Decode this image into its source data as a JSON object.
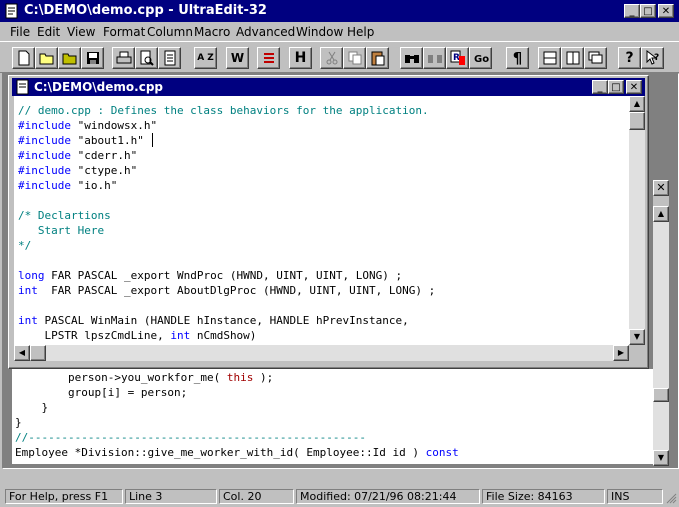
{
  "window": {
    "title": "C:\\DEMO\\demo.cpp - UltraEdit-32"
  },
  "menu": [
    "File",
    "Edit",
    "View",
    "Format",
    "Column",
    "Macro",
    "Advanced",
    "Window",
    "Help"
  ],
  "toolbar": {
    "az_label": "A Z",
    "wrap_label": "W",
    "h_label": "H",
    "pilcrow_label": "¶",
    "help_label": "?"
  },
  "child_window": {
    "title": "C:\\DEMO\\demo.cpp"
  },
  "editor_top": {
    "lines": [
      {
        "parts": [
          {
            "t": "// demo.cpp : Defines the class behaviors for the application.",
            "c": "com"
          }
        ]
      },
      {
        "parts": [
          {
            "t": "#include",
            "c": "kw"
          },
          {
            "t": " \"windowsx.h\"",
            "c": ""
          }
        ]
      },
      {
        "parts": [
          {
            "t": "#include",
            "c": "kw"
          },
          {
            "t": " \"about1.h\"",
            "c": ""
          }
        ]
      },
      {
        "parts": [
          {
            "t": "#include",
            "c": "kw"
          },
          {
            "t": " \"cderr.h\"",
            "c": ""
          }
        ]
      },
      {
        "parts": [
          {
            "t": "#include",
            "c": "kw"
          },
          {
            "t": " \"ctype.h\"",
            "c": ""
          }
        ]
      },
      {
        "parts": [
          {
            "t": "#include",
            "c": "kw"
          },
          {
            "t": " \"io.h\"",
            "c": ""
          }
        ]
      },
      {
        "parts": [
          {
            "t": "",
            "c": ""
          }
        ]
      },
      {
        "parts": [
          {
            "t": "/* Declartions",
            "c": "com"
          }
        ]
      },
      {
        "parts": [
          {
            "t": "   Start Here",
            "c": "com"
          }
        ]
      },
      {
        "parts": [
          {
            "t": "*/",
            "c": "com"
          }
        ]
      },
      {
        "parts": [
          {
            "t": "",
            "c": ""
          }
        ]
      },
      {
        "parts": [
          {
            "t": "long",
            "c": "kw"
          },
          {
            "t": " FAR PASCAL _export WndProc (HWND, UINT, UINT, LONG) ;",
            "c": ""
          }
        ]
      },
      {
        "parts": [
          {
            "t": "int",
            "c": "kw"
          },
          {
            "t": "  FAR PASCAL _export AboutDlgProc (HWND, UINT, UINT, LONG) ;",
            "c": ""
          }
        ]
      },
      {
        "parts": [
          {
            "t": "",
            "c": ""
          }
        ]
      },
      {
        "parts": [
          {
            "t": "int",
            "c": "kw"
          },
          {
            "t": " PASCAL WinMain (HANDLE hInstance, HANDLE hPrevInstance,",
            "c": ""
          }
        ]
      },
      {
        "parts": [
          {
            "t": "    LPSTR lpszCmdLine, ",
            "c": ""
          },
          {
            "t": "int",
            "c": "kw"
          },
          {
            "t": " nCmdShow)",
            "c": ""
          }
        ]
      }
    ]
  },
  "editor_bottom": {
    "lines": [
      {
        "parts": [
          {
            "t": "        person->you_workfor_me( ",
            "c": ""
          },
          {
            "t": "this",
            "c": "red"
          },
          {
            "t": " );",
            "c": ""
          }
        ]
      },
      {
        "parts": [
          {
            "t": "        group[i] = person;",
            "c": ""
          }
        ]
      },
      {
        "parts": [
          {
            "t": "    }",
            "c": ""
          }
        ]
      },
      {
        "parts": [
          {
            "t": "}",
            "c": ""
          }
        ]
      },
      {
        "parts": [
          {
            "t": "//---------------------------------------------------",
            "c": "com"
          }
        ]
      },
      {
        "parts": [
          {
            "t": "Employee *Division::give_me_worker_with_id( Employee::Id id ) ",
            "c": ""
          },
          {
            "t": "const",
            "c": "kw"
          }
        ]
      }
    ]
  },
  "status": {
    "help": "For Help, press F1",
    "line": "Line 3",
    "col": "Col. 20",
    "modified": "Modified: 07/21/96 08:21:44",
    "filesize": "File Size: 84163",
    "mode": "INS"
  },
  "colors": {
    "titlebar": "#000080",
    "comment": "#008080",
    "keyword": "#0000ff",
    "this_keyword": "#a00000"
  }
}
